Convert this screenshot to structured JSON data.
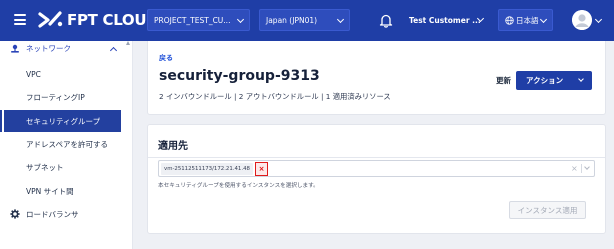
{
  "topbar": {
    "logo_text": "FPT CLOUD",
    "project_select": "PROJECT_TEST_CU...",
    "region_select": "Japan (JPN01)",
    "user_name": "Test Customer ...",
    "language": "日本語"
  },
  "sidebar": {
    "group_label": "ネットワーク",
    "items": [
      {
        "label": "VPC"
      },
      {
        "label": "フローティングIP"
      },
      {
        "label": "セキュリティグループ"
      },
      {
        "label": "アドレスペアを許可する"
      },
      {
        "label": "サブネット"
      },
      {
        "label": "VPN サイト間"
      }
    ],
    "load_balancer_label": "ロードバランサ",
    "active_index": 2
  },
  "header": {
    "back_label": "戻る",
    "title": "security-group-9313",
    "subtitle": "2 インバウンドルール | 2 アウトバウンドルール | 1 適用済みリソース",
    "refresh_label": "更新",
    "action_label": "アクション"
  },
  "apply": {
    "title": "適用先",
    "selected_chip": "vm-25112511173/172.21.41.48",
    "remove_symbol": "×",
    "clear_symbol": "×",
    "hint": "本セキュリティグループを使用するインスタンスを選択します。",
    "apply_button_label": "インスタンス適用"
  },
  "colors": {
    "brand": "#1f3ea6",
    "highlight": "#e01b1b",
    "link": "#1d4ed8"
  },
  "icons": {
    "menu": "hamburger-icon",
    "notifications": "bell-icon",
    "language": "globe-icon",
    "network": "network-icon",
    "load_balancer": "gear-icon"
  }
}
